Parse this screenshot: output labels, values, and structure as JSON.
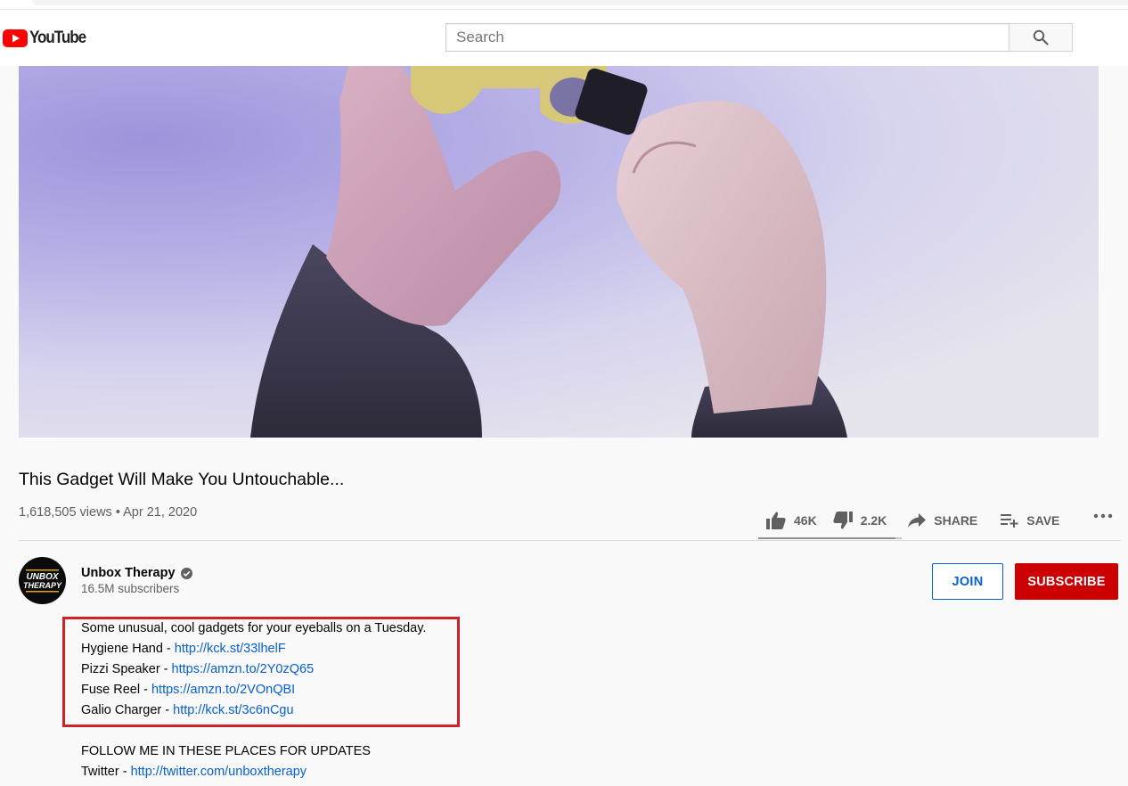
{
  "colors": {
    "brand_red": "#ff0000",
    "subscribe_red": "#cc0000",
    "link_blue": "#065fd4",
    "highlight_box_red": "#cc2229"
  },
  "masthead": {
    "logo_text": "YouTube",
    "search_placeholder": "Search",
    "search_icon": "search-icon"
  },
  "video": {
    "title": "This Gadget Will Make You Untouchable...",
    "views": "1,618,505 views",
    "separator": "•",
    "date": "Apr 21, 2020"
  },
  "actions": {
    "likes": "46K",
    "dislikes": "2.2K",
    "share_label": "SHARE",
    "save_label": "SAVE",
    "icons": [
      "thumb-up-icon",
      "thumb-down-icon",
      "share-icon",
      "playlist-add-icon",
      "more-icon"
    ],
    "like_ratio": 0.954
  },
  "channel": {
    "name": "Unbox Therapy",
    "subscribers": "16.5M subscribers",
    "avatar_text_1": "UNBOX",
    "avatar_text_2": "THERAPY",
    "join_label": "JOIN",
    "subscribe_label": "SUBSCRIBE"
  },
  "description": {
    "intro": "Some unusual, cool gadgets for your eyeballs on a Tuesday.",
    "items": [
      {
        "label": "Hygiene Hand - ",
        "link": "http://kck.st/33lhelF"
      },
      {
        "label": "Pizzi Speaker - ",
        "link": "https://amzn.to/2Y0zQ65"
      },
      {
        "label": "Fuse Reel - ",
        "link": "https://amzn.to/2VOnQBI"
      },
      {
        "label": "Galio Charger - ",
        "link": "http://kck.st/3c6nCgu"
      }
    ],
    "follow_heading": "FOLLOW ME IN THESE PLACES FOR UPDATES",
    "twitter": {
      "label": "Twitter - ",
      "link": "http://twitter.com/unboxtherapy"
    }
  }
}
